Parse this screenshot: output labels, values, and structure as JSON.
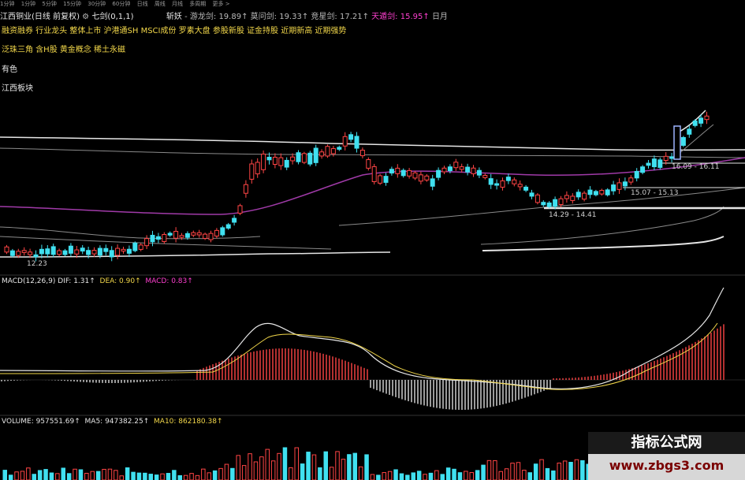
{
  "toolbar": {
    "items": [
      "1分钟",
      "1分钟",
      "5分钟",
      "15分钟",
      "30分钟",
      "60分钟",
      "日线",
      "周线",
      "月线",
      "多周期",
      "更多 >"
    ]
  },
  "header": {
    "stock": "江西铜业(日线 前复权)",
    "indicator": "七剑(0,1,1)",
    "sword1_label": "斩妖",
    "sword2_label": "- 游龙剑:",
    "sword2_value": "19.89↑",
    "sword3_label": "莫问剑:",
    "sword3_value": "19.33↑",
    "sword4_label": "竞星剑:",
    "sword4_value": "17.21↑",
    "sword5_label": "天遁剑:",
    "sword5_value": "15.95↑",
    "sword6_label": "日月"
  },
  "tags": {
    "line1": "融资融券 行业龙头 整体上市 沪港通SH MSCI成份 罗素大盘 参股新股 证金持股 近期新高 近期强势",
    "line2": "泛珠三角 含H股 黄金概念 稀土永磁",
    "line3": "有色",
    "line4": "江西板块"
  },
  "price_labels": {
    "low_left": "12.23",
    "range1": "16.09 - 16.11",
    "range2": "15.07 - 15.13",
    "range3": "14.29 - 14.41"
  },
  "macd": {
    "name": "MACD(12,26,9)",
    "dif": "DIF: 1.31↑",
    "dea": "DEA: 0.90↑",
    "macd": "MACD: 0.83↑"
  },
  "volume": {
    "vol": "VOLUME: 957551.69↑",
    "ma5": "MA5: 947382.25↑",
    "ma10": "MA10: 862180.38↑"
  },
  "watermark": {
    "title": "指标公式网",
    "url": "www.zbgs3.com"
  },
  "colors": {
    "up": "#ff4545",
    "down": "#40e0f0",
    "ma_purple": "#a03aa8",
    "band_white": "#e6e6e6",
    "band_gray": "#8a8a8a"
  }
}
